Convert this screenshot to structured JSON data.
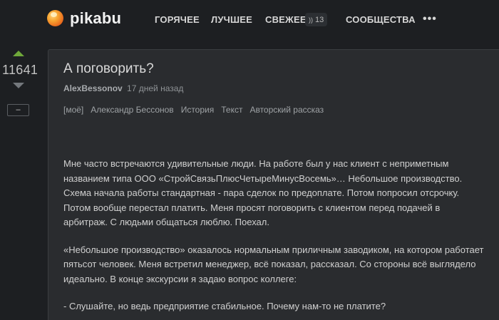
{
  "header": {
    "logo_text": "pikabu",
    "nav": {
      "hot": "ГОРЯЧЕЕ",
      "best": "ЛУЧШЕЕ",
      "fresh": "СВЕЖЕЕ",
      "fresh_count": "13",
      "communities": "СООБЩЕСТВА",
      "more": "•••"
    }
  },
  "post": {
    "rating": "11641",
    "collapse_label": "–",
    "title": "А поговорить?",
    "author": "AlexBessonov",
    "time": "17 дней назад",
    "tags": [
      "[моё]",
      "Александр Бессонов",
      "История",
      "Текст",
      "Авторский рассказ"
    ],
    "paragraphs": [
      "Мне часто встречаются удивительные люди. На работе был у нас клиент с неприметным названием типа ООО «СтройСвязьПлюсЧетыреМинусВосемь»… Небольшое производство. Схема начала работы стандартная - пара сделок по предоплате. Потом попросил отсрочку. Потом вообще перестал платить. Меня просят поговорить с клиентом перед подачей в арбитраж. С людьми общаться люблю. Поехал.",
      "«Небольшое производство» оказалось нормальным приличным заводиком, на котором работает пятьсот человек. Меня встретил менеджер, всё показал, рассказал. Со стороны всё выглядело идеально. В конце экскурсии я задаю вопрос коллеге:",
      "- Слушайте, но ведь предприятие стабильное. Почему нам-то не платите?"
    ]
  },
  "colors": {
    "background": "#1d1f22",
    "card": "#2a2c2f",
    "upvote": "#6fa83a",
    "logo_orange": "#f7a531"
  }
}
